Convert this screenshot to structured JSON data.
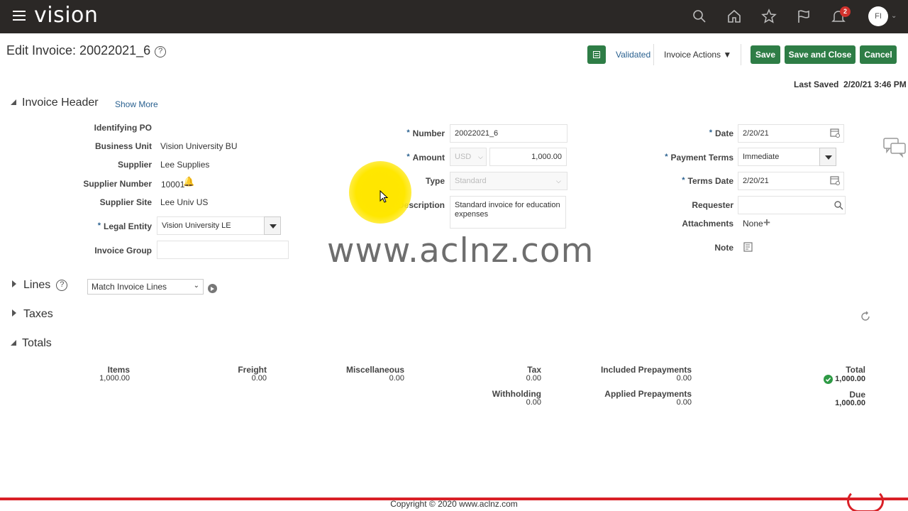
{
  "app": {
    "brand": "vision",
    "notification_count": "2",
    "user_initials": "FI"
  },
  "page": {
    "title": "Edit Invoice: 20022021_6",
    "help": "?"
  },
  "toolbar": {
    "status": "Validated",
    "actions_label": "Invoice Actions",
    "save_label": "Save",
    "save_close_label": "Save and Close",
    "cancel_label": "Cancel",
    "last_saved_label": "Last Saved",
    "last_saved_value": "2/20/21 3:46 PM"
  },
  "header": {
    "title": "Invoice Header",
    "show_more": "Show More",
    "identifying_po_label": "Identifying PO",
    "business_unit_label": "Business Unit",
    "business_unit": "Vision University BU",
    "supplier_label": "Supplier",
    "supplier": "Lee Supplies",
    "supplier_number_label": "Supplier Number",
    "supplier_number": "10001",
    "supplier_site_label": "Supplier Site",
    "supplier_site": "Lee Univ US",
    "legal_entity_label": "Legal Entity",
    "legal_entity": "Vision University LE",
    "invoice_group_label": "Invoice Group",
    "invoice_group": "",
    "number_label": "Number",
    "number": "20022021_6",
    "amount_label": "Amount",
    "currency": "USD",
    "amount": "1,000.00",
    "type_label": "Type",
    "type": "Standard",
    "description_label": "Description",
    "description": "Standard invoice for education expenses",
    "date_label": "Date",
    "date": "2/20/21",
    "payment_terms_label": "Payment Terms",
    "payment_terms": "Immediate",
    "terms_date_label": "Terms Date",
    "terms_date": "2/20/21",
    "requester_label": "Requester",
    "requester": "",
    "attachments_label": "Attachments",
    "attachments": "None",
    "note_label": "Note"
  },
  "watermark": "www.aclnz.com",
  "lines": {
    "title": "Lines",
    "match_select": "Match Invoice Lines"
  },
  "taxes": {
    "title": "Taxes"
  },
  "totals": {
    "title": "Totals",
    "items_label": "Items",
    "items": "1,000.00",
    "freight_label": "Freight",
    "freight": "0.00",
    "misc_label": "Miscellaneous",
    "misc": "0.00",
    "tax_label": "Tax",
    "tax": "0.00",
    "withholding_label": "Withholding",
    "withholding": "0.00",
    "included_prepayments_label": "Included Prepayments",
    "included_prepayments": "0.00",
    "applied_prepayments_label": "Applied Prepayments",
    "applied_prepayments": "0.00",
    "total_label": "Total",
    "total": "1,000.00",
    "due_label": "Due",
    "due": "1,000.00"
  },
  "footer": {
    "copyright": "Copyright © 2020 www.aclnz.com"
  },
  "colors": {
    "topbar": "#2b2826",
    "accent_green": "#2e7d46",
    "link_blue": "#2a6190",
    "footer_red": "#d92027"
  }
}
